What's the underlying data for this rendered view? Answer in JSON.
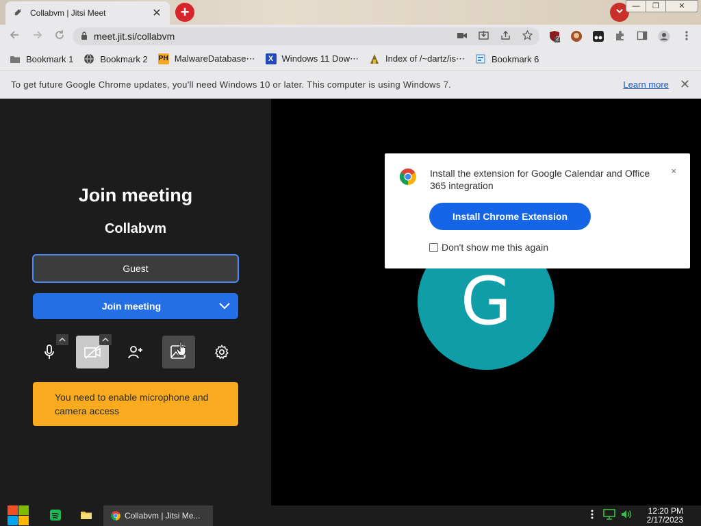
{
  "browser": {
    "tab": {
      "title": "Collabvm | Jitsi Meet",
      "close": "✕"
    },
    "new_tab": "+",
    "window_buttons": [
      "—",
      "❐",
      "✕"
    ],
    "url": "meet.jit.si/collabvm",
    "bookmarks": [
      {
        "label": "Bookmark 1",
        "icon": "folder-icon"
      },
      {
        "label": "Bookmark 2",
        "icon": "globe-icon"
      },
      {
        "label": "MalwareDatabase⋯",
        "icon": "ph-icon",
        "badge": "PH"
      },
      {
        "label": "Windows 11 Dow⋯",
        "icon": "x-icon",
        "badge": "X"
      },
      {
        "label": "Index of /~dartz/is⋯",
        "icon": "apache-icon"
      },
      {
        "label": "Bookmark 6",
        "icon": "page-icon"
      }
    ],
    "ext_badge": "2",
    "infobar": {
      "message": "To get future Google Chrome updates, you'll need Windows 10 or later. This computer is using Windows 7.",
      "link": "Learn more",
      "close": "✕"
    }
  },
  "prejoin": {
    "title": "Join meeting",
    "room": "Collabvm",
    "name_value": "Guest",
    "join_label": "Join meeting",
    "warning": "You need to enable microphone and camera access"
  },
  "video": {
    "avatar_initials": "G",
    "avatar_color": "#0f9ea8"
  },
  "extension_popup": {
    "text": "Install the extension for Google Calendar and Office 365 integration",
    "button": "Install Chrome Extension",
    "checkbox_label": "Don't show me this again",
    "close": "×"
  },
  "taskbar": {
    "task_title": "Collabvm | Jitsi Me...",
    "time": "12:20 PM",
    "date": "2/17/2023"
  },
  "colors": {
    "accent": "#246fe5",
    "warning": "#f8ab1f",
    "link": "#1a56c4"
  }
}
